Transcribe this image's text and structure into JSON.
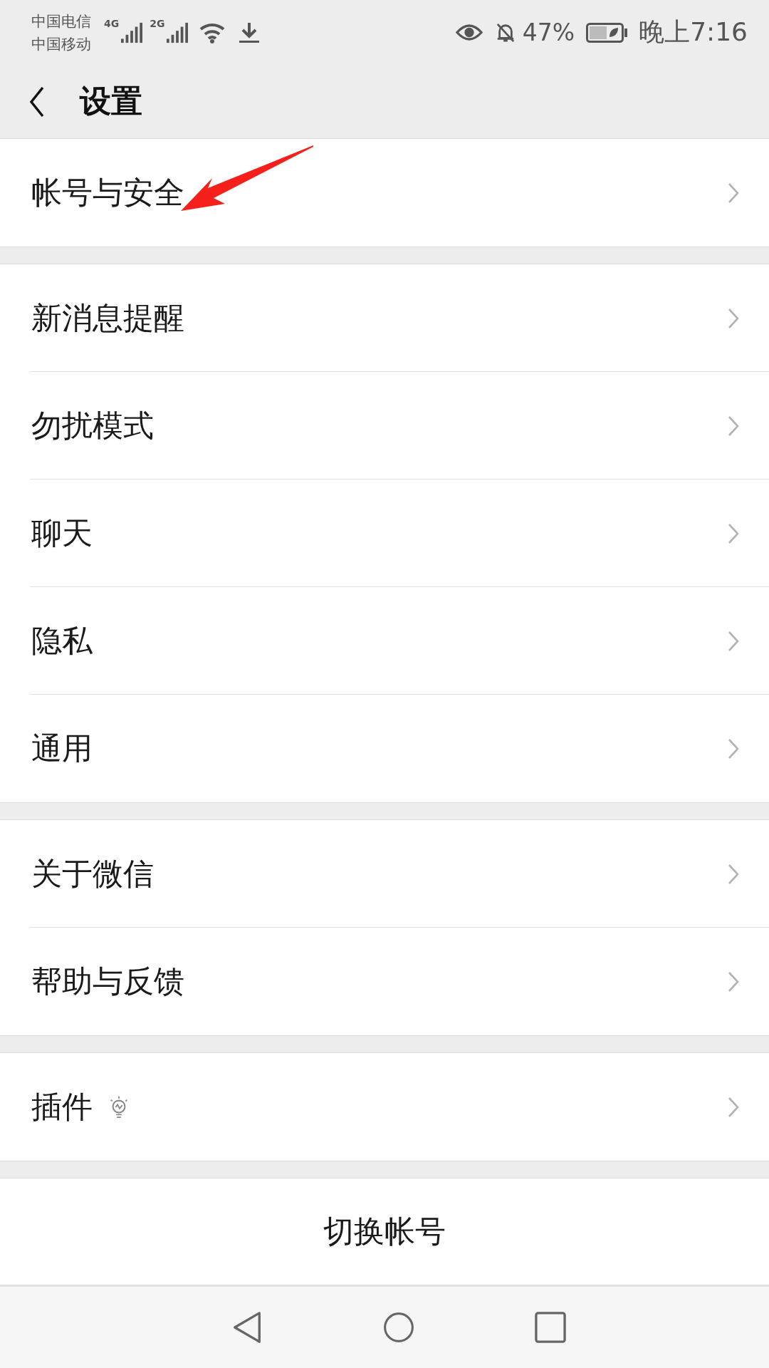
{
  "status_bar": {
    "carriers": [
      "中国电信",
      "中国移动"
    ],
    "networks": [
      "4G",
      "2G"
    ],
    "battery_percent": "47%",
    "time": "晚上7:16"
  },
  "header": {
    "title": "设置"
  },
  "groups": [
    {
      "items": [
        {
          "label": "帐号与安全",
          "kind": "plain"
        }
      ]
    },
    {
      "items": [
        {
          "label": "新消息提醒",
          "kind": "plain"
        },
        {
          "label": "勿扰模式",
          "kind": "plain"
        },
        {
          "label": "聊天",
          "kind": "plain"
        },
        {
          "label": "隐私",
          "kind": "plain"
        },
        {
          "label": "通用",
          "kind": "plain"
        }
      ]
    },
    {
      "items": [
        {
          "label": "关于微信",
          "kind": "plain"
        },
        {
          "label": "帮助与反馈",
          "kind": "plain"
        }
      ]
    },
    {
      "items": [
        {
          "label": "插件",
          "kind": "with-icon"
        }
      ]
    }
  ],
  "switch_account": {
    "label": "切换帐号"
  }
}
